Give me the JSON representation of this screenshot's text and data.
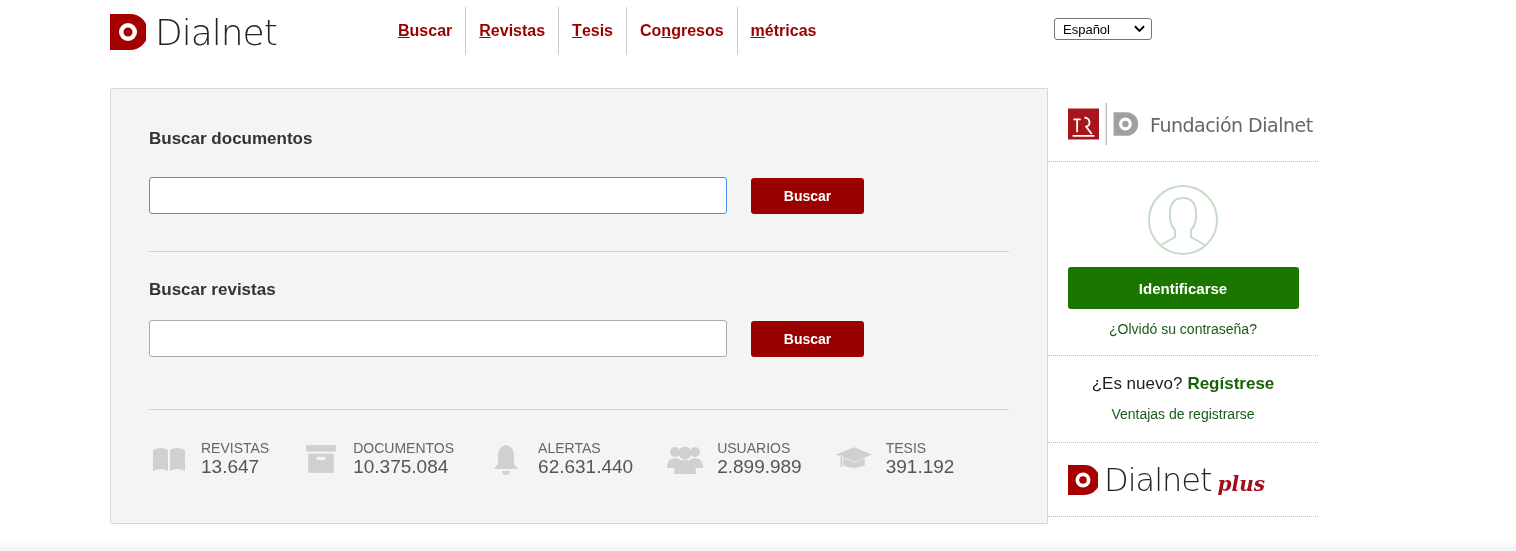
{
  "logo": {
    "text": "Dialnet"
  },
  "nav": [
    {
      "key": "B",
      "post": "uscar"
    },
    {
      "key": "R",
      "post": "evistas"
    },
    {
      "key": "T",
      "post": "esis"
    },
    {
      "pre": "Co",
      "key": "n",
      "post": "gresos"
    },
    {
      "key": "m",
      "post": "étricas"
    }
  ],
  "language": {
    "value": "Español"
  },
  "search_sections": [
    {
      "title": "Buscar documentos",
      "button": "Buscar",
      "focused": true
    },
    {
      "title": "Buscar revistas",
      "button": "Buscar",
      "focused": false
    }
  ],
  "stats": [
    {
      "kind": "book",
      "label": "REVISTAS",
      "value": "13.647"
    },
    {
      "kind": "archive",
      "label": "DOCUMENTOS",
      "value": "10.375.084"
    },
    {
      "kind": "bell",
      "label": "ALERTAS",
      "value": "62.631.440"
    },
    {
      "kind": "users",
      "label": "USUARIOS",
      "value": "2.899.989"
    },
    {
      "kind": "cap",
      "label": "TESIS",
      "value": "391.192"
    }
  ],
  "sidebar": {
    "foundation": "Fundación Dialnet",
    "login_button": "Identificarse",
    "forgot_link": "¿Olvidó su contraseña?",
    "new_prompt": "¿Es nuevo?",
    "register_link": "Regístrese",
    "benefits_link": "Ventajas de registrarse",
    "plus_logo": "Dialnet",
    "plus_suffix": "plus"
  }
}
